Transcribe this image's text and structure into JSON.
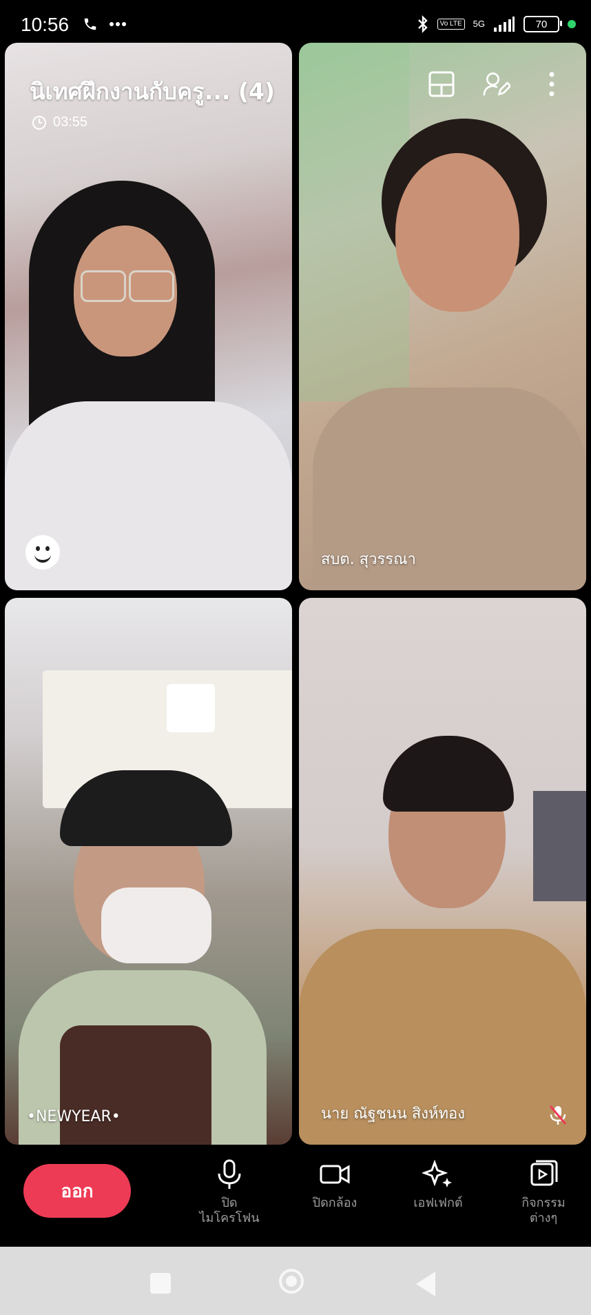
{
  "status_bar": {
    "time": "10:56",
    "network": "5G",
    "volte": "Vo LTE",
    "battery": "70",
    "icons": [
      "phone-icon",
      "more-dots-icon",
      "bluetooth-icon",
      "signal-icon",
      "battery-icon"
    ]
  },
  "call": {
    "title": "นิเทศฝึกงานกับครู... (4)",
    "duration": "03:55",
    "top_icons": [
      "layout-icon",
      "participant-edit-icon",
      "more-vertical-icon"
    ]
  },
  "participants": [
    {
      "name": "",
      "reaction_icon": "smiley-icon"
    },
    {
      "name": "สบต. สุวรรณา"
    },
    {
      "name": "•NEWYEAR•"
    },
    {
      "name": "นาย ณัฐชนน สิงห์ทอง",
      "muted": true
    }
  ],
  "controls": {
    "leave": "ออก",
    "mic": "ปิด\nไมโครโฟน",
    "camera": "ปิดกล้อง",
    "effects": "เอฟเฟกต์",
    "activities": "กิจกรรม\nต่างๆ"
  },
  "colors": {
    "leave_button": "#ee3b55",
    "control_text": "#9d9d9d",
    "online_dot": "#2fd46a",
    "nav_bar": "#dcdcdc"
  }
}
